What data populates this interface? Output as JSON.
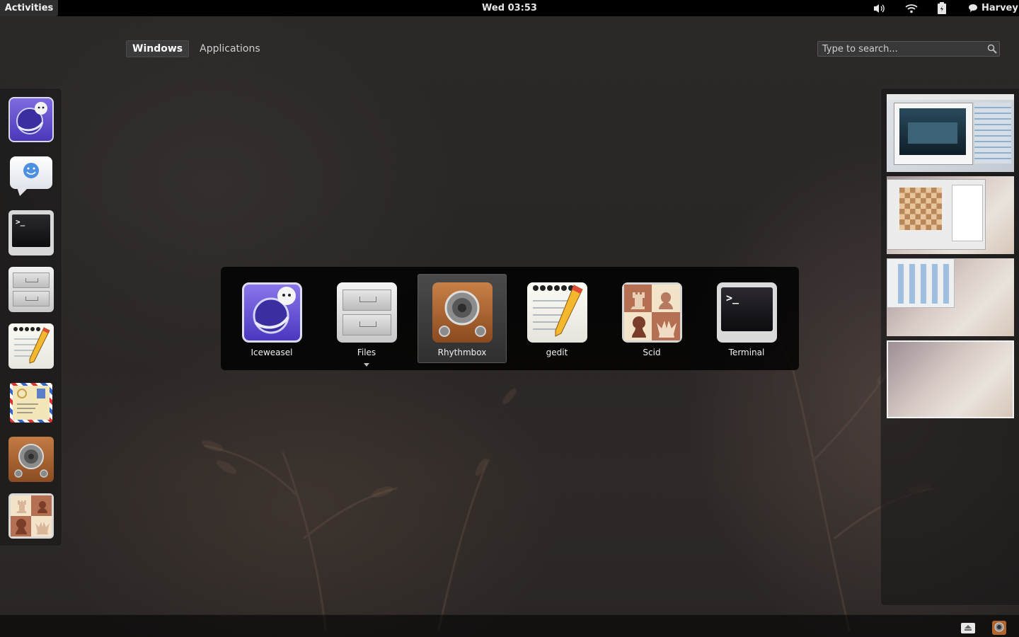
{
  "top_panel": {
    "activities_label": "Activities",
    "clock": "Wed 03:53",
    "user_name": "Harvey",
    "tray_icons": [
      "volume-icon",
      "wifi-icon",
      "battery-icon",
      "chat-status-icon"
    ]
  },
  "overview": {
    "tabs": [
      {
        "label": "Windows",
        "active": true
      },
      {
        "label": "Applications",
        "active": false
      }
    ],
    "search": {
      "placeholder": "Type to search...",
      "icon": "search-icon"
    }
  },
  "dash": {
    "items": [
      {
        "app": "Iceweasel",
        "icon": "iceweasel-icon"
      },
      {
        "app": "Empathy",
        "icon": "chat-bubble-icon"
      },
      {
        "app": "Terminal",
        "icon": "terminal-icon"
      },
      {
        "app": "Files",
        "icon": "file-cabinet-icon"
      },
      {
        "app": "gedit",
        "icon": "notepad-pencil-icon"
      },
      {
        "app": "Mail",
        "icon": "envelope-icon"
      },
      {
        "app": "Rhythmbox",
        "icon": "speaker-icon"
      },
      {
        "app": "Scid",
        "icon": "chess-icon"
      }
    ]
  },
  "switcher": {
    "selected_index": 2,
    "items": [
      {
        "label": "Iceweasel",
        "icon": "iceweasel-icon"
      },
      {
        "label": "Files",
        "icon": "file-cabinet-icon",
        "has_arrow": true
      },
      {
        "label": "Rhythmbox",
        "icon": "speaker-icon"
      },
      {
        "label": "gedit",
        "icon": "notepad-pencil-icon"
      },
      {
        "label": "Scid",
        "icon": "chess-icon"
      },
      {
        "label": "Terminal",
        "icon": "terminal-icon"
      }
    ]
  },
  "workspaces": {
    "count": 4,
    "active_index": 3
  },
  "bottom_tray": {
    "icons": [
      "removable-drive-icon",
      "rhythmbox-tray-icon"
    ]
  },
  "colors": {
    "panel": "#000000",
    "selection": "#4a4a4a",
    "iceweasel": "#5b46c8",
    "rhythmbox": "#a8612e",
    "scid": "#b98062"
  }
}
